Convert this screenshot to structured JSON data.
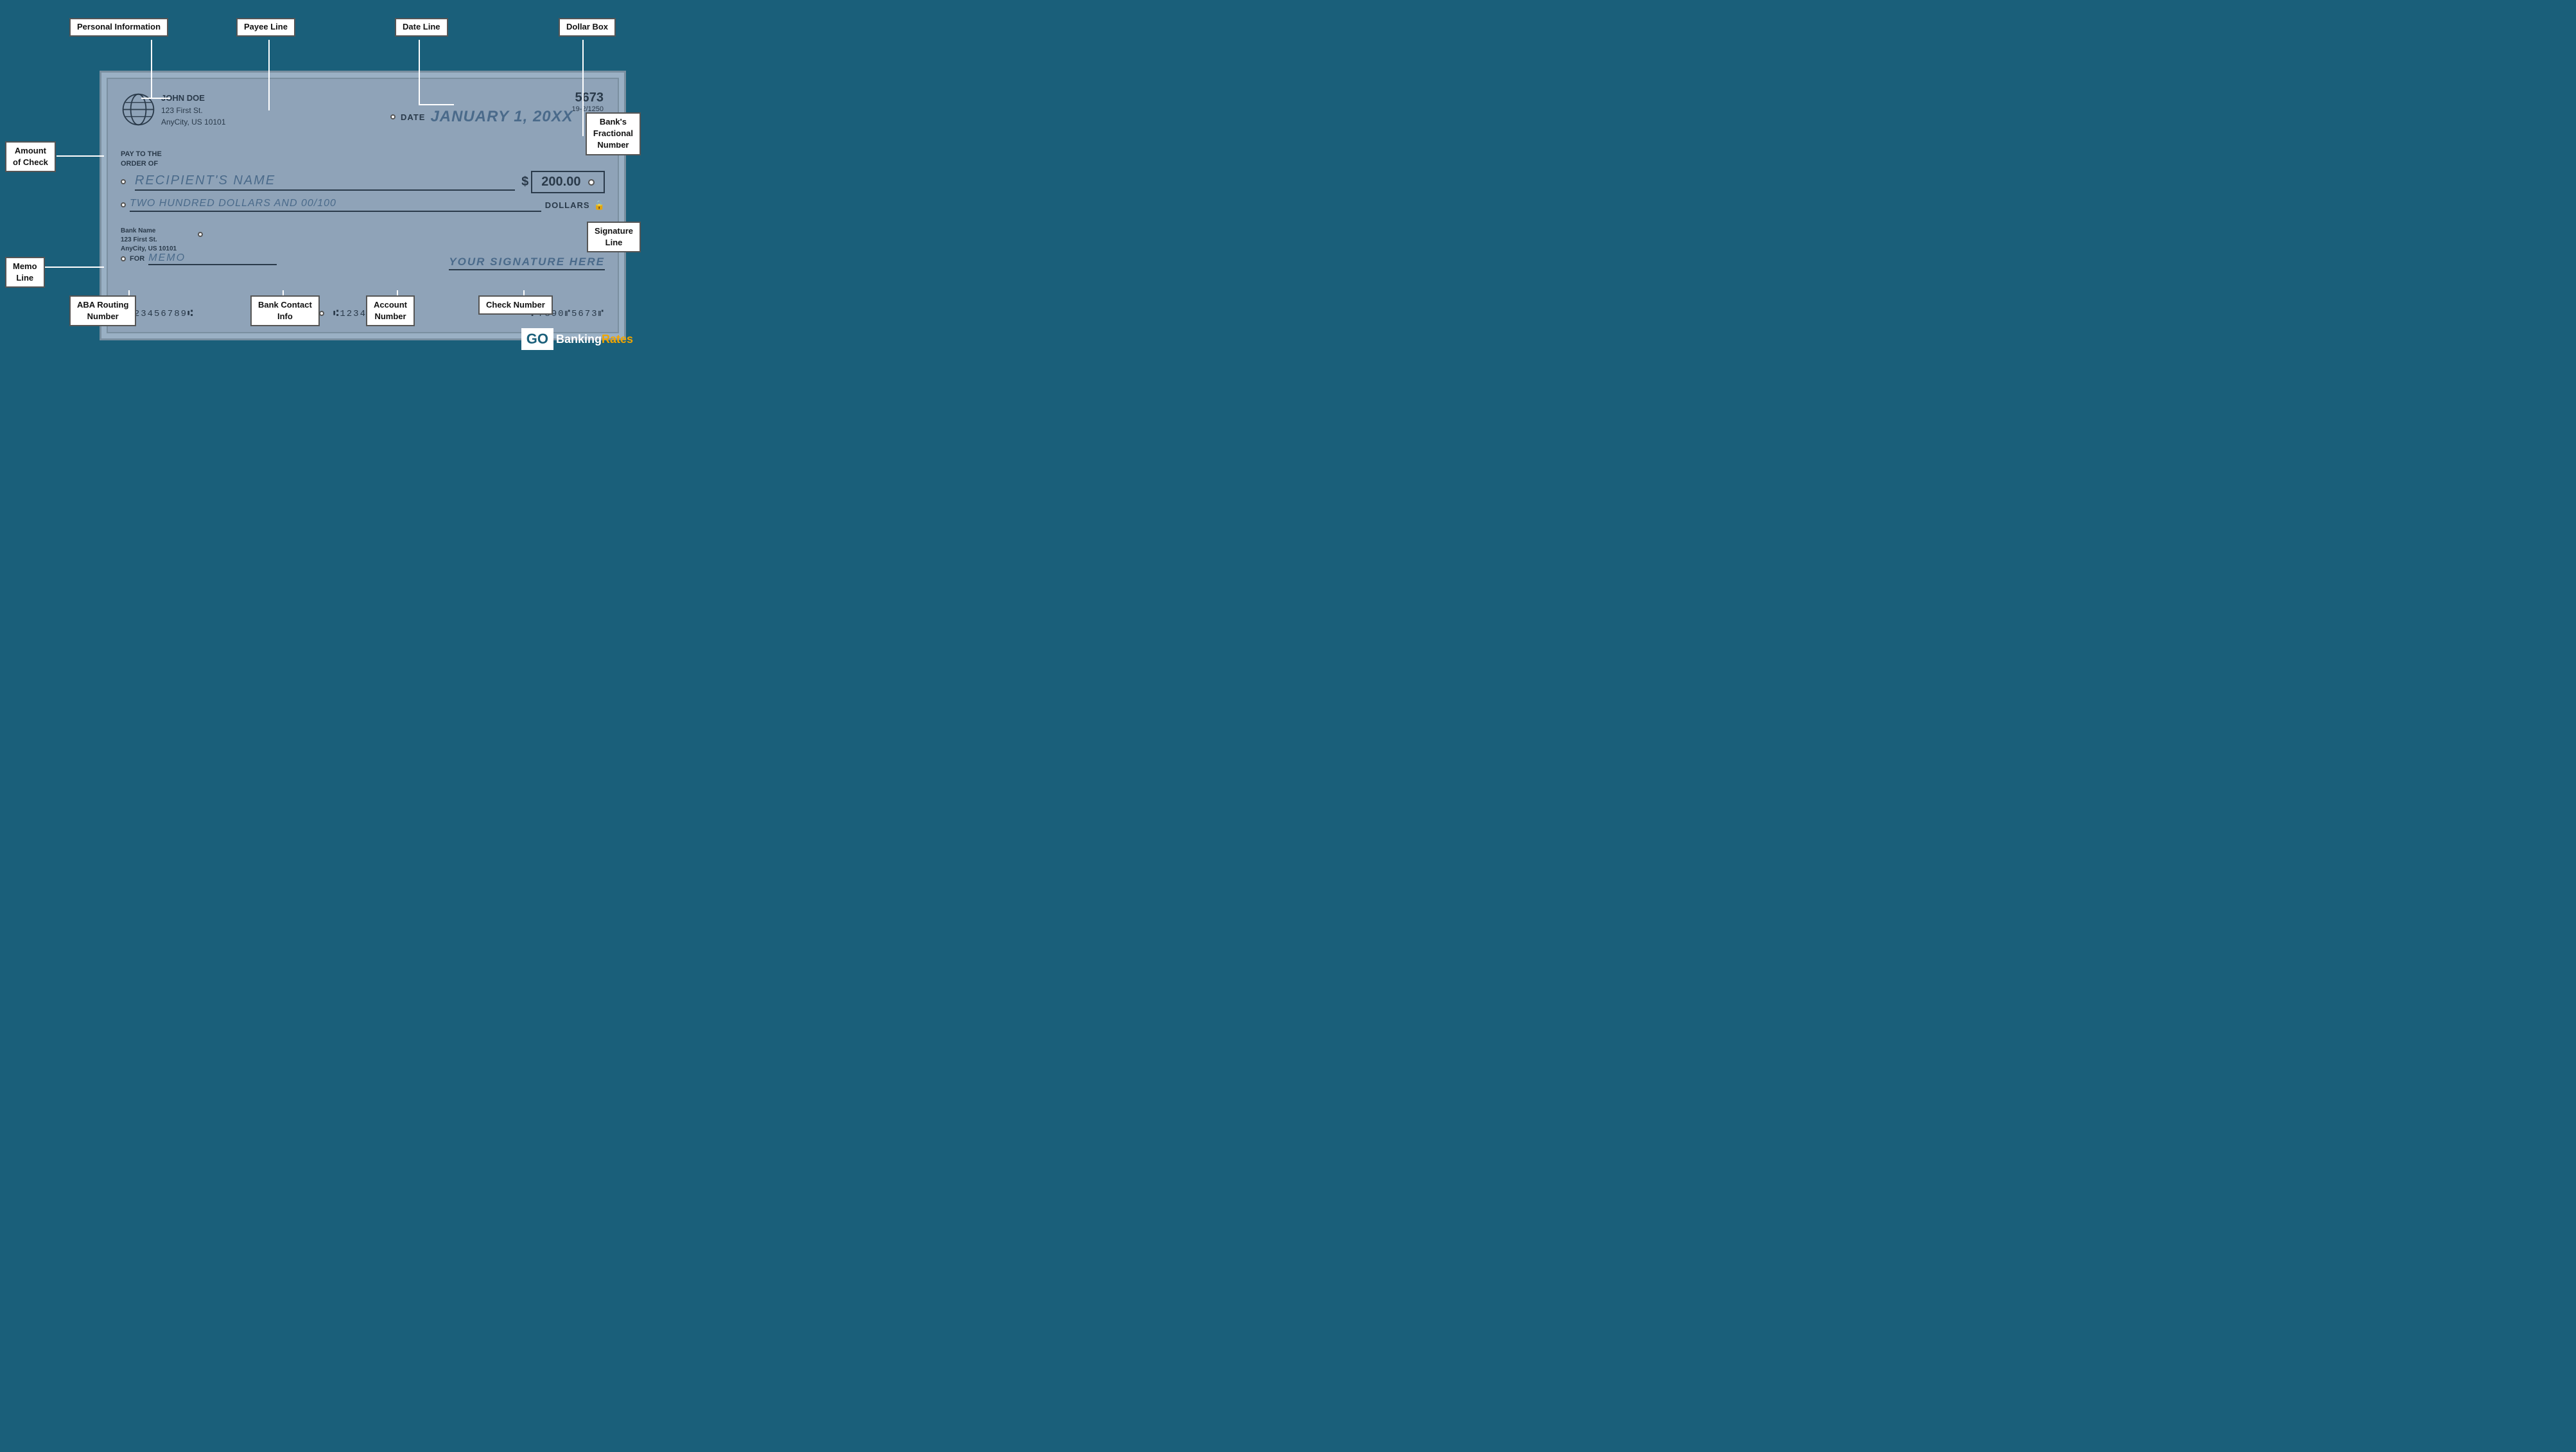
{
  "labels": {
    "personal_information": "Personal Information",
    "payee_line": "Payee Line",
    "date_line": "Date Line",
    "dollar_box": "Dollar Box",
    "banks_fractional_number": "Bank's\nFractional\nNumber",
    "amount_of_check": "Amount\nof Check",
    "signature_line": "Signature\nLine",
    "memo_line": "Memo\nLine",
    "aba_routing_number": "ABA Routing\nNumber",
    "bank_contact_info": "Bank Contact\nInfo",
    "account_number": "Account\nNumber",
    "check_number": "Check Number"
  },
  "check": {
    "number": "5673",
    "fractional": "19-2/1250",
    "account_holder_name": "JOHN DOE",
    "account_holder_address1": "123 First St.",
    "account_holder_city": "AnyCity, US 10101",
    "date_label": "DATE",
    "date_value": "JANUARY 1, 20XX",
    "pay_to_label1": "PAY TO THE",
    "pay_to_label2": "ORDER OF",
    "recipient_name": "RECIPIENT'S NAME",
    "dollar_sign": "$",
    "amount": "200.00",
    "written_amount": "TWO HUNDRED DOLLARS AND 00/100",
    "dollars_label": "DOLLARS",
    "bank_name": "Bank Name",
    "bank_address1": "123 First St.",
    "bank_city": "AnyCity, US 10101",
    "for_label": "FOR",
    "memo_text": "MEMO",
    "signature_text": "YOUR SIGNATURE HERE",
    "micr_routing": "⑆123456789⑆",
    "micr_bank": "⑆123456789⑆",
    "micr_account": "⑇7890⑈5673⑈"
  },
  "logo": {
    "go": "GO",
    "banking": "Banking",
    "rates": "Rates"
  }
}
